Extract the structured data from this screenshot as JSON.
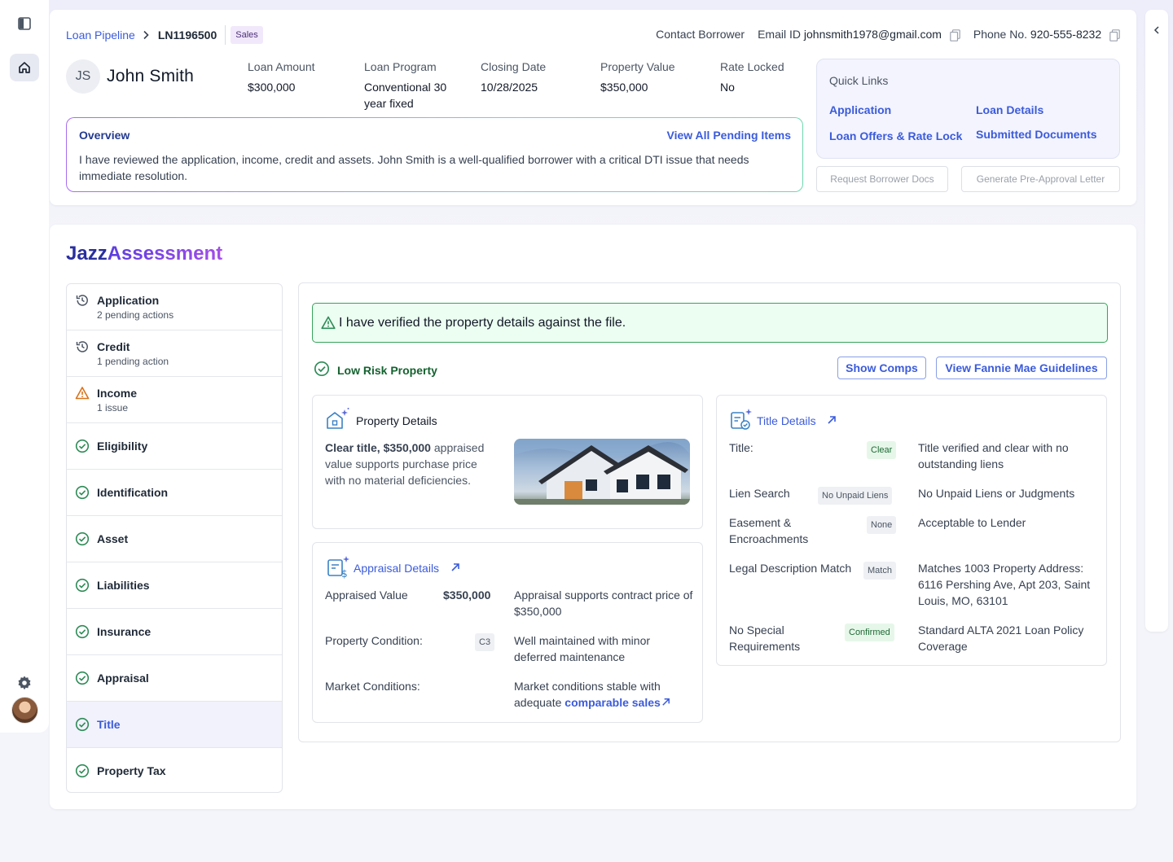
{
  "breadcrumb": {
    "root": "Loan Pipeline",
    "loan_id": "LN1196500",
    "badge": "Sales"
  },
  "contact": {
    "contact_label": "Contact Borrower",
    "email_label": "Email ID",
    "email": "johnsmith1978@gmail.com",
    "phone_label": "Phone No.",
    "phone": "920-555-8232"
  },
  "borrower": {
    "initials": "JS",
    "name": "John Smith"
  },
  "loan_summary": [
    {
      "label": "Loan Amount",
      "value": "$300,000"
    },
    {
      "label": "Loan Program",
      "value": "Conventional 30 year fixed"
    },
    {
      "label": "Closing Date",
      "value": "10/28/2025"
    },
    {
      "label": "Property Value",
      "value": "$350,000"
    },
    {
      "label": "Rate Locked",
      "value": "No"
    }
  ],
  "overview": {
    "title": "Overview",
    "link": "View All Pending Items",
    "text": "I have reviewed the application, income, credit and assets. John Smith is a well-qualified borrower with a critical DTI issue that needs immediate resolution."
  },
  "quick_links": {
    "title": "Quick Links",
    "items": [
      "Application",
      "Loan Details",
      "Loan Offers & Rate Lock",
      "Submitted Documents"
    ]
  },
  "actions": {
    "request_docs": "Request Borrower Docs",
    "preapproval": "Generate Pre-Approval Letter"
  },
  "assessment": {
    "title_a": "Jazz",
    "title_b": "Assessment"
  },
  "nav": [
    {
      "label": "Application",
      "sub": "2 pending actions",
      "status": "pending"
    },
    {
      "label": "Credit",
      "sub": "1 pending action",
      "status": "pending"
    },
    {
      "label": "Income",
      "sub": "1 issue",
      "status": "issue"
    },
    {
      "label": "Eligibility",
      "status": "ok"
    },
    {
      "label": "Identification",
      "status": "ok"
    },
    {
      "label": "Asset",
      "status": "ok"
    },
    {
      "label": "Liabilities",
      "status": "ok"
    },
    {
      "label": "Insurance",
      "status": "ok"
    },
    {
      "label": "Appraisal",
      "status": "ok"
    },
    {
      "label": "Title",
      "status": "ok",
      "active": true
    },
    {
      "label": "Property Tax",
      "status": "ok"
    }
  ],
  "banner": "I have verified the property details against the file.",
  "risk": "Low Risk Property",
  "buttons": {
    "comps": "Show Comps",
    "guidelines": "View Fannie Mae Guidelines"
  },
  "property_details": {
    "title": "Property Details",
    "bold": "Clear title, $350,000",
    "text": " appraised value supports purchase price with no material deficiencies."
  },
  "appraisal": {
    "title": "Appraisal Details",
    "rows": [
      {
        "label": "Appraised Value",
        "value": "$350,000",
        "note": "Appraisal supports contract price of $350,000"
      },
      {
        "label": "Property Condition:",
        "chip": "C3",
        "note": "Well maintained with minor deferred maintenance"
      },
      {
        "label": "Market Conditions:",
        "note_pre": "Market conditions stable with adequate ",
        "note_link": "comparable sales"
      }
    ]
  },
  "title_details": {
    "title": "Title Details",
    "rows": [
      {
        "label": "Title:",
        "chip": "Clear",
        "note": "Title verified and clear with no outstanding liens"
      },
      {
        "label": "Lien Search",
        "chip": "No Unpaid Liens",
        "note": "No Unpaid Liens or Judgments"
      },
      {
        "label": "Easement & Encroachments",
        "chip": "None",
        "note": "Acceptable to Lender"
      },
      {
        "label": "Legal Description Match",
        "chip": "Match",
        "note": "Matches 1003 Property Address: 6116 Pershing Ave, Apt 203, Saint Louis, MO, 63101"
      },
      {
        "label": "No Special Requirements",
        "chip": "Confirmed",
        "note": "Standard ALTA 2021 Loan Policy Coverage"
      }
    ]
  },
  "colors": {
    "accent": "#3b5bdb",
    "success": "#2e8b57",
    "warning": "#d9731a"
  }
}
